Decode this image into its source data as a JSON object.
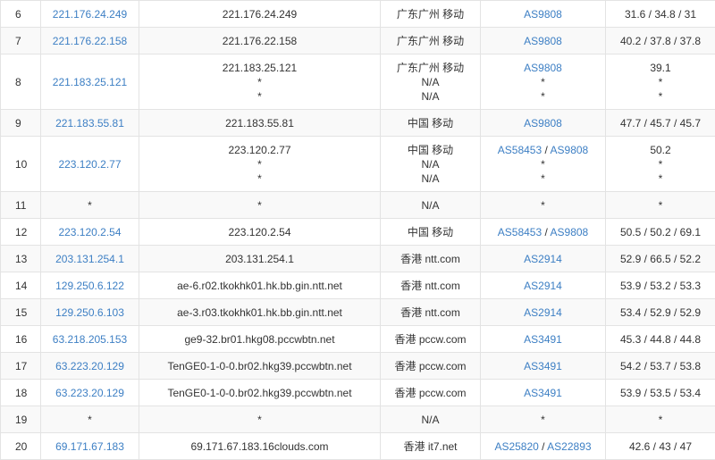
{
  "rows": [
    {
      "hop": "6",
      "ip": "221.176.24.249",
      "host": [
        "221.176.24.249"
      ],
      "loc": [
        "广东广州 移动"
      ],
      "asn": [
        [
          "AS9808"
        ]
      ],
      "rtt": [
        "31.6 / 34.8 / 31"
      ]
    },
    {
      "hop": "7",
      "ip": "221.176.22.158",
      "host": [
        "221.176.22.158"
      ],
      "loc": [
        "广东广州 移动"
      ],
      "asn": [
        [
          "AS9808"
        ]
      ],
      "rtt": [
        "40.2 / 37.8 / 37.8"
      ]
    },
    {
      "hop": "8",
      "ip": "221.183.25.121",
      "host": [
        "221.183.25.121",
        "*",
        "*"
      ],
      "loc": [
        "广东广州 移动",
        "N/A",
        "N/A"
      ],
      "asn": [
        [
          "AS9808"
        ],
        [
          "*"
        ],
        [
          "*"
        ]
      ],
      "rtt": [
        "39.1",
        "*",
        "*"
      ]
    },
    {
      "hop": "9",
      "ip": "221.183.55.81",
      "host": [
        "221.183.55.81"
      ],
      "loc": [
        "中国 移动"
      ],
      "asn": [
        [
          "AS9808"
        ]
      ],
      "rtt": [
        "47.7 / 45.7 / 45.7"
      ]
    },
    {
      "hop": "10",
      "ip": "223.120.2.77",
      "host": [
        "223.120.2.77",
        "*",
        "*"
      ],
      "loc": [
        "中国 移动",
        "N/A",
        "N/A"
      ],
      "asn": [
        [
          "AS58453",
          "AS9808"
        ],
        [
          "*"
        ],
        [
          "*"
        ]
      ],
      "rtt": [
        "50.2",
        "*",
        "*"
      ]
    },
    {
      "hop": "11",
      "ip": "*",
      "host": [
        "*"
      ],
      "loc": [
        "N/A"
      ],
      "asn": [
        [
          "*"
        ]
      ],
      "rtt": [
        "*"
      ]
    },
    {
      "hop": "12",
      "ip": "223.120.2.54",
      "host": [
        "223.120.2.54"
      ],
      "loc": [
        "中国 移动"
      ],
      "asn": [
        [
          "AS58453",
          "AS9808"
        ]
      ],
      "rtt": [
        "50.5 / 50.2 / 69.1"
      ]
    },
    {
      "hop": "13",
      "ip": "203.131.254.1",
      "host": [
        "203.131.254.1"
      ],
      "loc": [
        "香港 ntt.com"
      ],
      "asn": [
        [
          "AS2914"
        ]
      ],
      "rtt": [
        "52.9 / 66.5 / 52.2"
      ]
    },
    {
      "hop": "14",
      "ip": "129.250.6.122",
      "host": [
        "ae-6.r02.tkokhk01.hk.bb.gin.ntt.net"
      ],
      "loc": [
        "香港 ntt.com"
      ],
      "asn": [
        [
          "AS2914"
        ]
      ],
      "rtt": [
        "53.9 / 53.2 / 53.3"
      ]
    },
    {
      "hop": "15",
      "ip": "129.250.6.103",
      "host": [
        "ae-3.r03.tkokhk01.hk.bb.gin.ntt.net"
      ],
      "loc": [
        "香港 ntt.com"
      ],
      "asn": [
        [
          "AS2914"
        ]
      ],
      "rtt": [
        "53.4 / 52.9 / 52.9"
      ]
    },
    {
      "hop": "16",
      "ip": "63.218.205.153",
      "host": [
        "ge9-32.br01.hkg08.pccwbtn.net"
      ],
      "loc": [
        "香港 pccw.com"
      ],
      "asn": [
        [
          "AS3491"
        ]
      ],
      "rtt": [
        "45.3 / 44.8 / 44.8"
      ]
    },
    {
      "hop": "17",
      "ip": "63.223.20.129",
      "host": [
        "TenGE0-1-0-0.br02.hkg39.pccwbtn.net"
      ],
      "loc": [
        "香港 pccw.com"
      ],
      "asn": [
        [
          "AS3491"
        ]
      ],
      "rtt": [
        "54.2 / 53.7 / 53.8"
      ]
    },
    {
      "hop": "18",
      "ip": "63.223.20.129",
      "host": [
        "TenGE0-1-0-0.br02.hkg39.pccwbtn.net"
      ],
      "loc": [
        "香港 pccw.com"
      ],
      "asn": [
        [
          "AS3491"
        ]
      ],
      "rtt": [
        "53.9 / 53.5 / 53.4"
      ]
    },
    {
      "hop": "19",
      "ip": "*",
      "host": [
        "*"
      ],
      "loc": [
        "N/A"
      ],
      "asn": [
        [
          "*"
        ]
      ],
      "rtt": [
        "*"
      ]
    },
    {
      "hop": "20",
      "ip": "69.171.67.183",
      "host": [
        "69.171.67.183.16clouds.com"
      ],
      "loc": [
        "香港 it7.net"
      ],
      "asn": [
        [
          "AS25820",
          "AS22893"
        ]
      ],
      "rtt": [
        "42.6 / 43 / 47"
      ]
    }
  ],
  "asn_separator": " / ",
  "colors": {
    "link": "#3d7fc4",
    "text": "#333333",
    "border": "#e3e3e3",
    "stripe": "#f9f9f9"
  }
}
